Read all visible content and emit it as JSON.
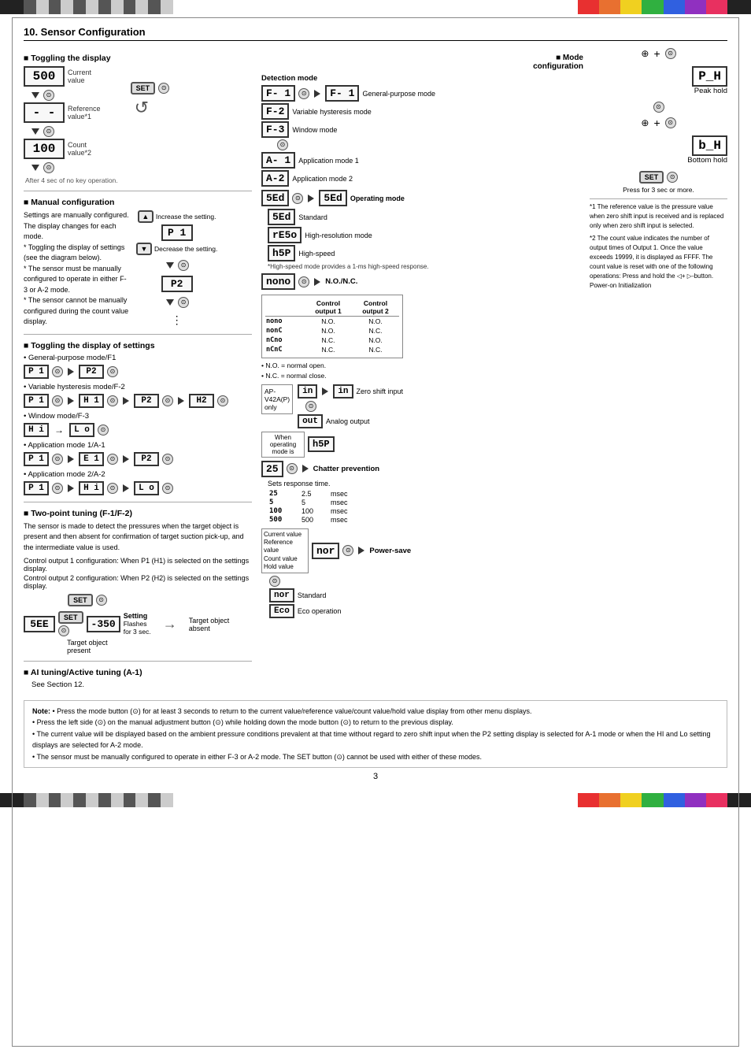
{
  "page": {
    "title": "10. Sensor Configuration",
    "page_number": "3"
  },
  "top_bar": {
    "left_label": "decorative-stripes",
    "right_label": "color-blocks"
  },
  "toggling_display": {
    "heading": "■ Toggling the display",
    "items": [
      {
        "display": "500",
        "label": "Current value"
      },
      {
        "display": "-  -",
        "label": "Reference value*1"
      },
      {
        "display": "100",
        "label": "Count value*2"
      }
    ],
    "after_note": "After 4 sec of no key operation."
  },
  "manual_config": {
    "heading": "■ Manual configuration",
    "description": "Settings are manually configured. The display changes for each mode.",
    "notes": [
      "* Toggling the display of settings (see the diagram below).",
      "* The sensor must be manually configured to operate in either F-3 or A-2 mode.",
      "* The sensor cannot be manually configured during the count value display."
    ],
    "increase_label": "Increase the setting.",
    "decrease_label": "Decrease the setting.",
    "display_P1": "P 1",
    "display_P2": "P2"
  },
  "toggling_settings": {
    "heading": "■ Toggling the display of settings",
    "modes": [
      {
        "name": "General-purpose mode/F1",
        "displays": [
          "P 1",
          "P2"
        ]
      },
      {
        "name": "Variable hysteresis mode/F-2",
        "displays": [
          "P 1",
          "H 1",
          "P2",
          "H2"
        ]
      },
      {
        "name": "Window mode/F-3",
        "displays": [
          "H i",
          "L o"
        ]
      },
      {
        "name": "Application mode 1/A-1",
        "displays": [
          "P 1",
          "E 1",
          "P2"
        ]
      },
      {
        "name": "Application mode 2/A-2",
        "displays": [
          "P 1",
          "H i",
          "L o"
        ]
      }
    ]
  },
  "two_point_tuning": {
    "heading": "■ Two-point tuning (F-1/F-2)",
    "description": "The sensor is made to detect the pressures when the target object is present and then absent for confirmation of target suction pick-up, and the intermediate value is used.",
    "control_output1": "Control output 1 configuration: When P1 (H1) is selected on the settings display.",
    "control_output2": "Control output 2 configuration: When P2 (H2) is selected on the settings display.",
    "diagram": {
      "present": {
        "display1": "5EE",
        "display2": "-350",
        "label": "Setting",
        "sublabel": "Flashes for 3 sec.",
        "target_label": "Target object present"
      },
      "absent": {
        "target_label": "Target object absent"
      }
    }
  },
  "ai_tuning": {
    "heading": "■ AI tuning/Active tuning (A-1)",
    "description": "See Section 12."
  },
  "mode_config": {
    "heading": "■ Mode configuration",
    "detection_heading": "Detection mode",
    "modes": [
      {
        "code": "F- 1",
        "label": "General-purpose mode"
      },
      {
        "code": "F-2",
        "label": "Variable hysteresis mode"
      },
      {
        "code": "F-3",
        "label": "Window mode"
      },
      {
        "code": "A- 1",
        "label": "Application mode 1"
      },
      {
        "code": "A-2",
        "label": "Application mode 2"
      }
    ],
    "operating_heading": "Operating mode",
    "operating_modes": [
      {
        "code": "5Ed",
        "label": "Standard"
      },
      {
        "code": "rE5o",
        "label": "High-resolution mode"
      },
      {
        "code": "h5P",
        "label": "High-speed"
      }
    ],
    "highspeed_note": "*High-speed mode provides a 1-ms high-speed response.",
    "no_nc_heading": "N.O./N.C.",
    "no_nc_label": "nono",
    "no_nc_table": {
      "headers": [
        "",
        "Control output 1",
        "Control output 2"
      ],
      "rows": [
        {
          "code": "nono",
          "out1": "N.O.",
          "out2": "N.O."
        },
        {
          "code": "nonC",
          "out1": "N.O.",
          "out2": "N.C."
        },
        {
          "code": "nCno",
          "out1": "N.C.",
          "out2": "N.O."
        },
        {
          "code": "nCnC",
          "out1": "N.C.",
          "out2": "N.C."
        }
      ],
      "note": "• N.O. = normal open.\n• N.C. = normal close."
    },
    "ap_label": "AP-V42A(P) only",
    "analog_label": "in",
    "analog_zero_shift": "Zero shift input",
    "analog_output": "Analog output",
    "analog_out_code": "out",
    "when_operating_label": "When operating mode is",
    "h5p_display": "h5P",
    "chatter_heading": "Chatter prevention",
    "chatter_desc": "Sets response time.",
    "chatter_values": [
      {
        "code": "25",
        "val": "2.5",
        "unit": "msec"
      },
      {
        "code": "5",
        "val": "5",
        "unit": "msec"
      },
      {
        "code": "100",
        "val": "100",
        "unit": "msec"
      },
      {
        "code": "500",
        "val": "500",
        "unit": "msec"
      }
    ],
    "power_save_heading": "Power-save",
    "power_save_label": "nor",
    "power_save_modes": [
      {
        "code": "nor",
        "label": "Standard"
      },
      {
        "code": "Eco",
        "label": "Eco operation"
      }
    ],
    "current_value_label": "Current value",
    "reference_value_label": "Reference value",
    "count_value_label": "Count value",
    "hold_value_label": "Hold value"
  },
  "peak_hold": {
    "code": "P_H",
    "label": "Peak hold"
  },
  "bottom_hold": {
    "code": "b_H",
    "label": "Bottom hold"
  },
  "footnotes_right": [
    "*1 The reference value is the pressure value when zero shift input is received and is replaced only when zero shift input is selected.",
    "*2 The count value indicates the number of output times of Output 1. Once the value exceeds 19999, it is displayed as FFFF. The count value is reset with one of the following operations: Press and hold the ◁+ ▷-button. Power-on Initialization"
  ],
  "press_note": "Press for 3 sec or more.",
  "note_bullets": [
    "Press the mode button (⊙) for at least 3 seconds to return to the current value/reference value/count value/hold value display from other menu displays.",
    "Press the left side (⊙) on the manual adjustment button (⊙) while holding down the mode button (⊙) to return to the previous display.",
    "The current value will be displayed based on the ambient pressure conditions prevalent at that time without regard to zero shift input when the P2 setting display is selected for A-1 mode or when the HI and Lo setting displays are selected for A-2 mode.",
    "The sensor must be manually configured to operate in either F-3 or A-2 mode. The SET button (⊙) cannot be used with either of these modes."
  ]
}
